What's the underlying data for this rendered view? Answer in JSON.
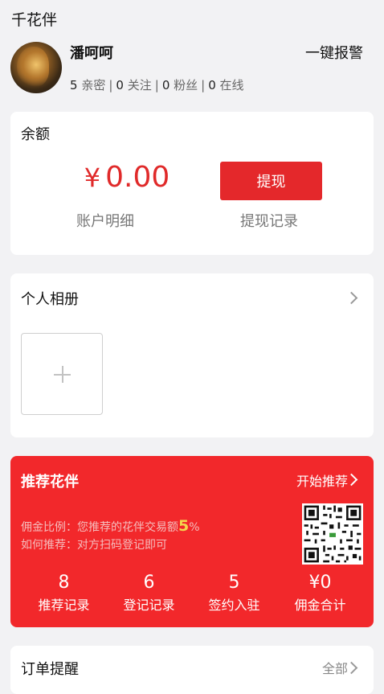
{
  "app": {
    "title": "千花伴"
  },
  "header": {
    "alarm_label": "一键报警"
  },
  "user": {
    "name": "潘呵呵",
    "stats": [
      {
        "value": "5",
        "label": "亲密"
      },
      {
        "value": "0",
        "label": "关注"
      },
      {
        "value": "0",
        "label": "粉丝"
      },
      {
        "value": "0",
        "label": "在线"
      }
    ]
  },
  "balance": {
    "heading": "余额",
    "currency": "¥",
    "amount": "0.00",
    "withdraw_button": "提现",
    "account_detail_link": "账户明细",
    "withdraw_history_link": "提现记录"
  },
  "album": {
    "heading": "个人相册",
    "chevron_icon": "chevron-right-icon",
    "add_icon": "plus-icon"
  },
  "referral": {
    "heading": "推荐花伴",
    "start_link": "开始推荐",
    "commission_prefix": "佣金比例：您推荐的花伴交易额",
    "commission_rate": "5",
    "commission_unit": "%",
    "how_to": "如何推荐：对方扫码登记即可",
    "stats": [
      {
        "value": "8",
        "label": "推荐记录"
      },
      {
        "value": "6",
        "label": "登记记录"
      },
      {
        "value": "5",
        "label": "签约入驻"
      },
      {
        "value": "¥0",
        "label": "佣金合计"
      }
    ],
    "accent_color": "#f2282b"
  },
  "orders": {
    "heading": "订单提醒",
    "all_link": "全部"
  }
}
